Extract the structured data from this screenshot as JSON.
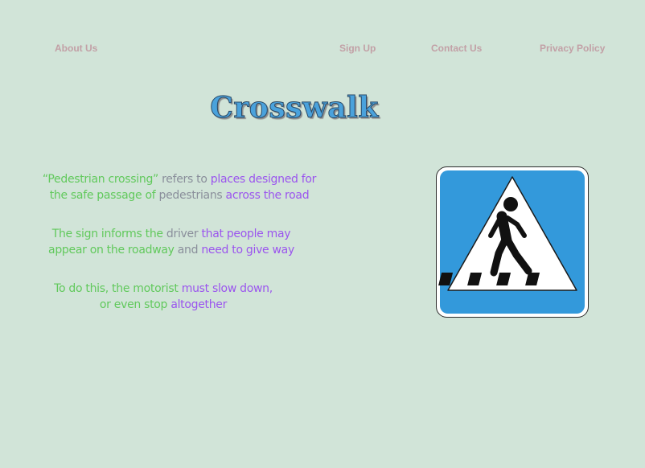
{
  "nav": {
    "about": "About Us",
    "signup": "Sign Up",
    "contact": "Contact Us",
    "privacy": "Privacy Policy"
  },
  "title": "Crosswalk",
  "paragraphs": {
    "p1": {
      "seg1": "“Pedestrian crossing”",
      "seg2": " refers to ",
      "seg3": "places designed for",
      "seg4": "the safe passage of ",
      "seg5": "pedestrians",
      "seg6": " across the road"
    },
    "p2": {
      "seg1": "The sign informs the ",
      "seg2": "driver",
      "seg3": " that people may",
      "seg4": "appear on the roadway",
      "seg5": " and ",
      "seg6": "need to give way"
    },
    "p3": {
      "seg1": "To do this, the motorist",
      "seg2": " must slow down,",
      "seg3": "or even stop ",
      "seg4": "altogether"
    }
  },
  "sign": {
    "icon": "pedestrian-crossing-sign-icon",
    "colors": {
      "background": "#3399db",
      "triangle": "#ffffff",
      "figure": "#111111"
    }
  },
  "colors": {
    "page_background": "#d1e4d8",
    "nav_text": "#c2a0a6",
    "title_fill": "#4aa2dc",
    "text_green": "#61c95c",
    "text_gray": "#8a8f9b",
    "text_purple": "#9b55ee"
  }
}
